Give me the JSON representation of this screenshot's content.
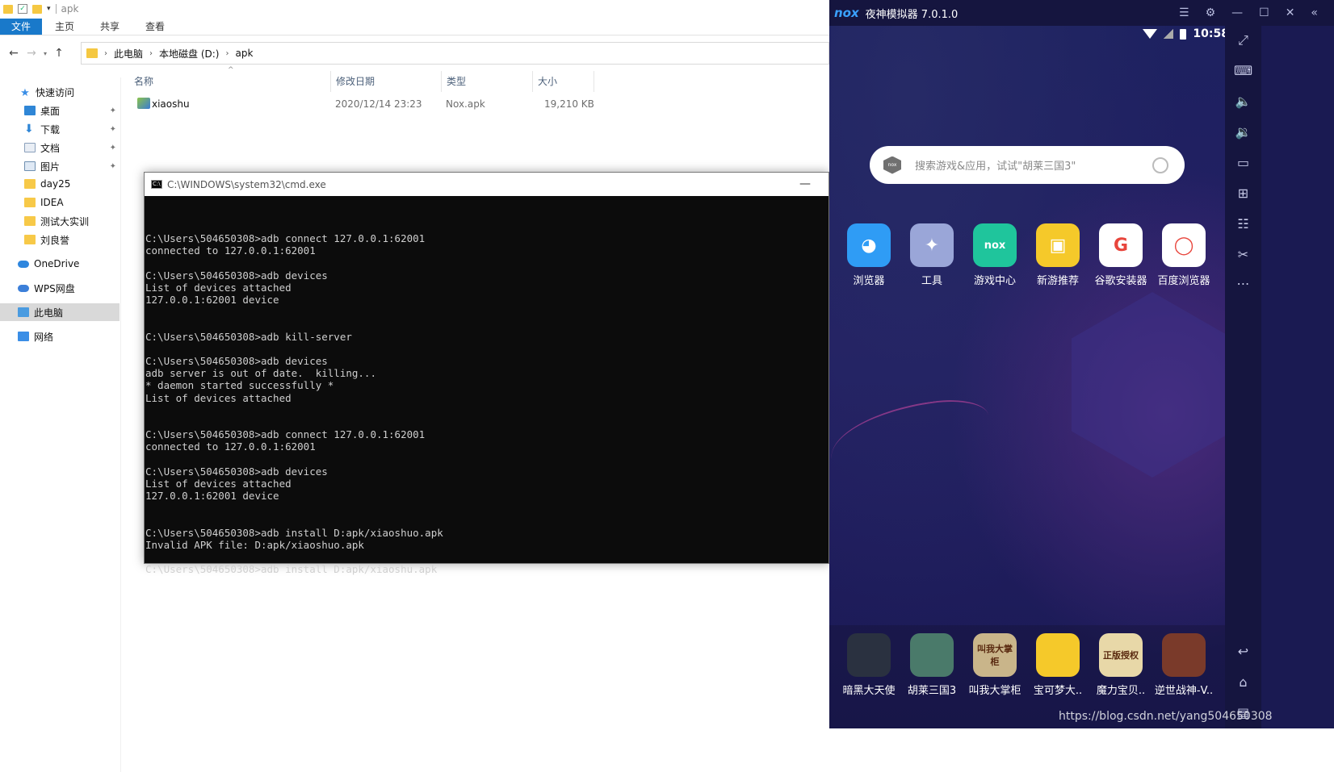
{
  "explorer": {
    "title": "apk",
    "ribbon_tabs": [
      "文件",
      "主页",
      "共享",
      "查看"
    ],
    "breadcrumb": [
      "此电脑",
      "本地磁盘 (D:)",
      "apk"
    ],
    "nav": {
      "quick_access": "快速访问",
      "pinned": [
        "桌面",
        "下载",
        "文档",
        "图片"
      ],
      "folders": [
        "day25",
        "IDEA",
        "测试大实训",
        "刘良誉"
      ],
      "onedrive": "OneDrive",
      "wps": "WPS网盘",
      "this_pc": "此电脑",
      "network": "网络"
    },
    "columns": {
      "name": "名称",
      "date": "修改日期",
      "type": "类型",
      "size": "大小"
    },
    "files": [
      {
        "name": "xiaoshu",
        "date": "2020/12/14 23:23",
        "type": "Nox.apk",
        "size": "19,210 KB"
      }
    ]
  },
  "cmd": {
    "title": "C:\\WINDOWS\\system32\\cmd.exe",
    "lines": [
      "",
      "C:\\Users\\504650308>adb connect 127.0.0.1:62001",
      "connected to 127.0.0.1:62001",
      "",
      "C:\\Users\\504650308>adb devices",
      "List of devices attached",
      "127.0.0.1:62001 device",
      "",
      "",
      "C:\\Users\\504650308>adb kill-server",
      "",
      "C:\\Users\\504650308>adb devices",
      "adb server is out of date.  killing...",
      "* daemon started successfully *",
      "List of devices attached",
      "",
      "",
      "C:\\Users\\504650308>adb connect 127.0.0.1:62001",
      "connected to 127.0.0.1:62001",
      "",
      "C:\\Users\\504650308>adb devices",
      "List of devices attached",
      "127.0.0.1:62001 device",
      "",
      "",
      "C:\\Users\\504650308>adb install D:apk/xiaoshuo.apk",
      "Invalid APK file: D:apk/xiaoshuo.apk",
      "",
      "C:\\Users\\504650308>adb install D:apk/xiaoshu.apk"
    ]
  },
  "nox": {
    "logo": "nox",
    "title": "夜神模拟器 7.0.1.0",
    "time": "10:58",
    "search_placeholder": "搜索游戏&应用，试试\"胡莱三国3\"",
    "search_badge": "nox",
    "apps": [
      {
        "label": "浏览器",
        "glyph": "◕",
        "color": "#2f9cf5"
      },
      {
        "label": "工具",
        "glyph": "✦",
        "color": "#9aa6d8"
      },
      {
        "label": "游戏中心",
        "glyph": "nox",
        "color": "#1fc59c"
      },
      {
        "label": "新游推荐",
        "glyph": "▣",
        "color": "#f5c92a"
      },
      {
        "label": "谷歌安装器",
        "glyph": "G",
        "color": "#ffffff"
      },
      {
        "label": "百度浏览器",
        "glyph": "◯",
        "color": "#ffffff"
      }
    ],
    "dock_apps": [
      {
        "label": "暗黑大天使",
        "color": "#2a3140"
      },
      {
        "label": "胡莱三国3",
        "color": "#4a7a6a"
      },
      {
        "label": "叫我大掌柜",
        "color": "#c9b58a",
        "glyph": "叫我大掌柜"
      },
      {
        "label": "宝可梦大..",
        "color": "#f5c92a"
      },
      {
        "label": "魔力宝贝..",
        "color": "#e8d8a8",
        "glyph": "正版授权"
      },
      {
        "label": "逆世战神-V..",
        "color": "#7a3a2a"
      }
    ],
    "watermark": "https://blog.csdn.net/yang504650308"
  }
}
